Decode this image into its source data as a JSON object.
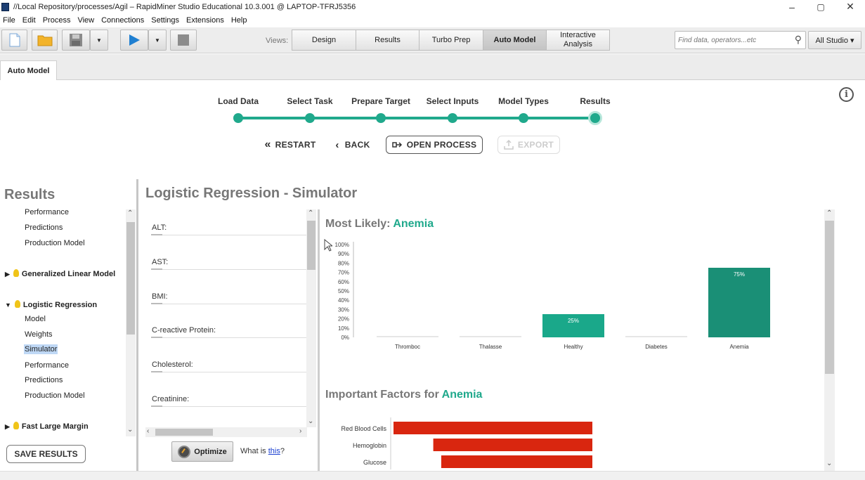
{
  "window": {
    "title": "//Local Repository/processes/Agil – RapidMiner Studio Educational 10.3.001 @ LAPTOP-TFRJ5356",
    "minimize": "–",
    "maximize": "▢",
    "close": "✕"
  },
  "menu": [
    "File",
    "Edit",
    "Process",
    "View",
    "Connections",
    "Settings",
    "Extensions",
    "Help"
  ],
  "toolbar": {
    "views_label": "Views:",
    "views": [
      "Design",
      "Results",
      "Turbo Prep",
      "Auto Model",
      "Interactive Analysis"
    ],
    "active_view": "Auto Model",
    "search_placeholder": "Find data, operators...etc",
    "studio_dropdown": "All Studio ▾"
  },
  "tab": {
    "label": "Auto Model"
  },
  "wizard": {
    "steps": [
      "Load Data",
      "Select Task",
      "Prepare Target",
      "Select Inputs",
      "Model Types",
      "Results"
    ],
    "current_step": "Results",
    "restart": "RESTART",
    "back": "BACK",
    "open_process": "OPEN PROCESS",
    "export": "EXPORT"
  },
  "results_panel": {
    "title": "Results",
    "items": {
      "perf1": "Performance",
      "pred1": "Predictions",
      "prod1": "Production Model",
      "glm": "Generalized Linear Model",
      "lr": "Logistic Regression",
      "model": "Model",
      "weights": "Weights",
      "simulator": "Simulator",
      "perf2": "Performance",
      "pred2": "Predictions",
      "prod2": "Production Model",
      "flm": "Fast Large Margin"
    },
    "save_button": "SAVE RESULTS"
  },
  "simulator": {
    "title": "Logistic Regression - Simulator",
    "inputs": [
      "ALT:",
      "AST:",
      "BMI:",
      "C-reactive Protein:",
      "Cholesterol:",
      "Creatinine:"
    ],
    "optimize": "Optimize",
    "what_is": "What is ",
    "what_is_link": "this",
    "what_is_q": "?"
  },
  "result": {
    "most_likely_label": "Most Likely: ",
    "most_likely_value": "Anemia",
    "important_label": "Important Factors for ",
    "important_value": "Anemia"
  },
  "chart_data": [
    {
      "type": "bar",
      "categories": [
        "Thromboc",
        "Thalasse",
        "Healthy",
        "Diabetes",
        "Anemia"
      ],
      "values": [
        0,
        0,
        25,
        0,
        75
      ],
      "data_labels": [
        "",
        "",
        "25%",
        "",
        "75%"
      ],
      "yticks": [
        "0%",
        "10%",
        "20%",
        "30%",
        "40%",
        "50%",
        "60%",
        "70%",
        "80%",
        "90%",
        "100%"
      ],
      "ylim": [
        0,
        100
      ],
      "color": "#1aa88a",
      "highlight_color": "#1a8f76"
    },
    {
      "type": "bar",
      "orientation": "horizontal",
      "categories": [
        "Red Blood Cells",
        "Hemoglobin",
        "Glucose"
      ],
      "values": [
        1.0,
        0.8,
        0.76
      ],
      "color": "#d9260f"
    }
  ]
}
